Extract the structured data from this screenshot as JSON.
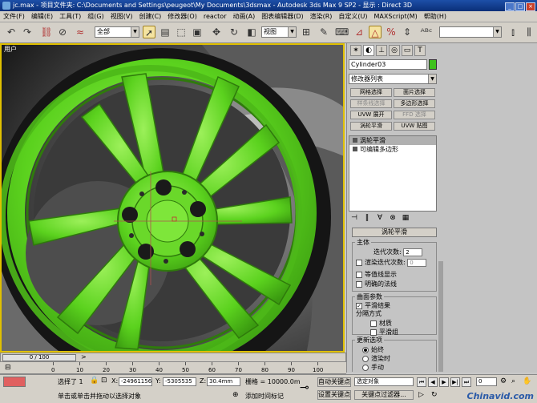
{
  "title_bar": {
    "text": "jc.max   - 项目文件夹: C:\\Documents and Settings\\peugeot\\My Documents\\3dsmax   - Autodesk 3ds Max 9 SP2      - 显示 : Direct 3D"
  },
  "menu": [
    "文件(F)",
    "编辑(E)",
    "工具(T)",
    "组(G)",
    "视图(V)",
    "创建(C)",
    "修改器(O)",
    "reactor",
    "动画(A)",
    "图表编辑器(D)",
    "渲染(R)",
    "自定义(U)",
    "MAXScript(M)",
    "帮助(H)"
  ],
  "toolbar": {
    "selection_filter": "全部",
    "reference_coord": "视图",
    "named_selection": ""
  },
  "viewport": {
    "label": "用户"
  },
  "command_panel": {
    "object_name": "Cylinder03",
    "object_color": "#3ec21c",
    "modifier_list": "修改器列表",
    "buttons": [
      {
        "label": "网格选择",
        "dim": false
      },
      {
        "label": "面片选择",
        "dim": false
      },
      {
        "label": "样条线选择",
        "dim": true
      },
      {
        "label": "多边形选择",
        "dim": false
      },
      {
        "label": "UVW 展开",
        "dim": false
      },
      {
        "label": "FFD 选择",
        "dim": true
      },
      {
        "label": "涡轮平滑",
        "dim": false
      },
      {
        "label": "UVW 贴图",
        "dim": false
      }
    ],
    "stack": [
      "涡轮平滑",
      "可编辑多边形"
    ],
    "rollout_title": "涡轮平滑",
    "main_group": "主体",
    "iterations_label": "迭代次数:",
    "iterations_value": "2",
    "render_iters_label": "渲染迭代次数:",
    "render_iters_value": "0",
    "isoline_label": "等值线显示",
    "explicit_normals_label": "明确的法线",
    "surface_group": "曲面参数",
    "smooth_result_label": "平滑结果",
    "separate_label": "分隔方式",
    "materials_label": "材质",
    "smoothing_groups_label": "平滑组",
    "update_group": "更新选项",
    "always_label": "始终",
    "when_rendering_label": "渲染时",
    "manually_label": "手动"
  },
  "timeline": {
    "slider": "0 / 100",
    "ticks": [
      "0",
      "10",
      "20",
      "30",
      "40",
      "50",
      "60",
      "70",
      "80",
      "90",
      "100"
    ]
  },
  "status": {
    "selected": "选择了 1",
    "x_label": "X:",
    "x_value": "-24961156",
    "y_label": "Y:",
    "y_value": "-5305535",
    "z_label": "Z:",
    "z_value": "30.4mm",
    "grid_label": "栅格 = 10000.0m",
    "prompt": "单击或单击并拖动以选择对象",
    "add_time_tag": "添加时间标记",
    "auto_key": "自动关键点",
    "set_key": "设置关键点",
    "key_selection": "选定对象",
    "key_filters": "关键点过滤器...",
    "frame": "0",
    "watermark": "Chinavid.com"
  }
}
